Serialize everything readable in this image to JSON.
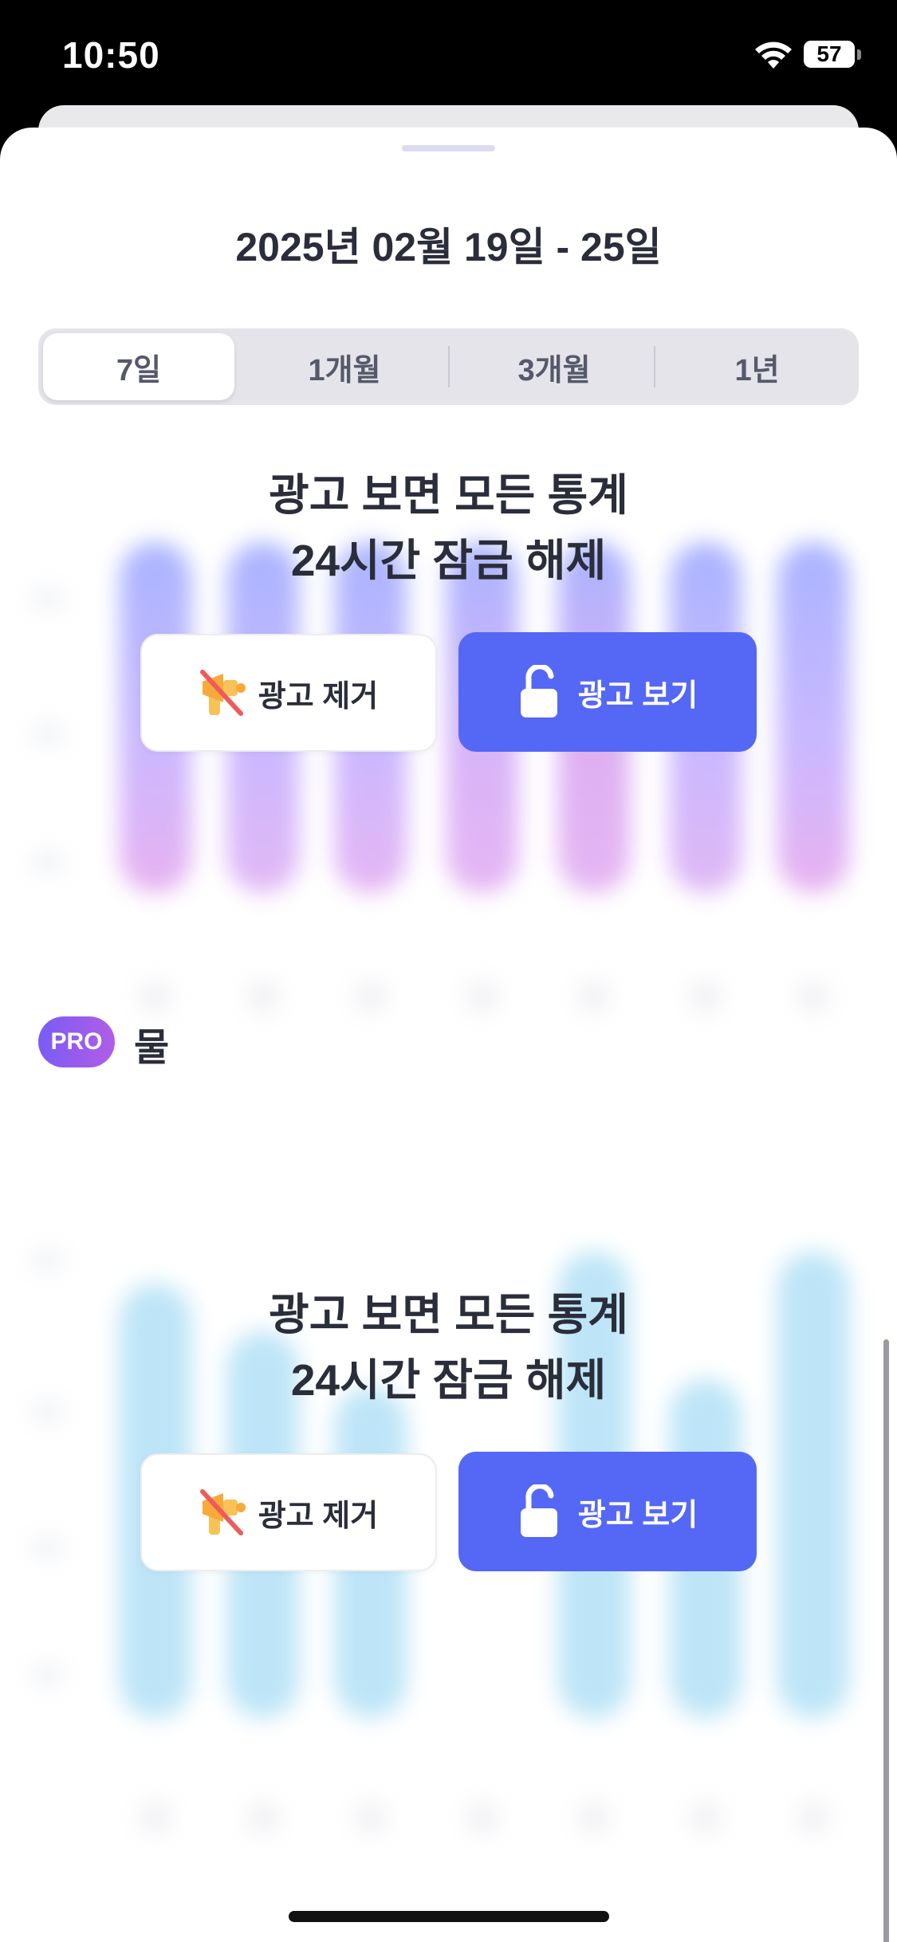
{
  "status_bar": {
    "time": "10:50",
    "battery_level": "57",
    "wifi_icon": "wifi-icon"
  },
  "sheet": {
    "date_range": "2025년 02월 19일 - 25일",
    "period_tabs": [
      {
        "label": "7일",
        "selected": true
      },
      {
        "label": "1개월",
        "selected": false
      },
      {
        "label": "3개월",
        "selected": false
      },
      {
        "label": "1년",
        "selected": false
      }
    ]
  },
  "locked_sections": [
    {
      "overlay_title_line1": "광고 보면 모든 통계",
      "overlay_title_line2": "24시간 잠금 해제",
      "remove_ads_label": "광고 제거",
      "watch_ad_label": "광고 보기",
      "icons": {
        "remove": "muted-megaphone-icon",
        "watch": "unlock-icon"
      }
    },
    {
      "badge": "PRO",
      "title": "물",
      "overlay_title_line1": "광고 보면 모든 통계",
      "overlay_title_line2": "24시간 잠금 해제",
      "remove_ads_label": "광고 제거",
      "watch_ad_label": "광고 보기",
      "icons": {
        "remove": "muted-megaphone-icon",
        "watch": "unlock-icon"
      }
    }
  ],
  "colors": {
    "primary_button": "#5567f5",
    "pro_badge_start": "#7a5cf5",
    "pro_badge_end": "#b15de6",
    "chart1_top": "#aab4ff",
    "chart1_mid": "#c9b8ff",
    "chart1_bottom": "#e8b2f0",
    "chart2_bar": "#bde5f7"
  }
}
